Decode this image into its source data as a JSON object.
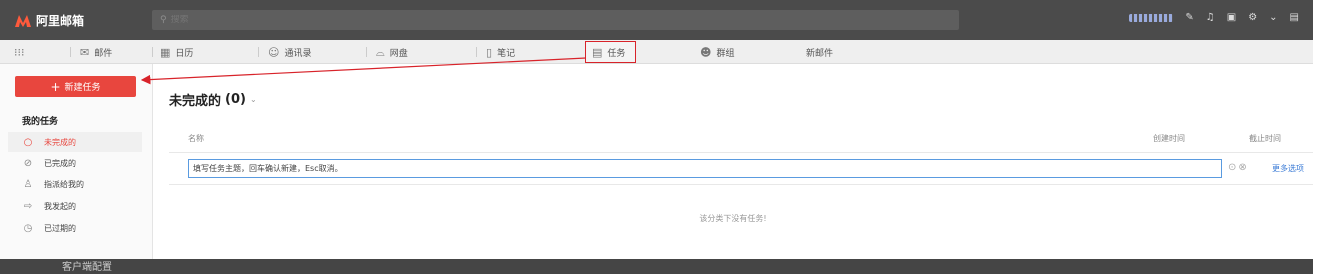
{
  "app": {
    "logo_text": "阿里邮箱"
  },
  "search": {
    "placeholder": "搜索"
  },
  "nav": {
    "items": [
      {
        "label": "邮件"
      },
      {
        "label": "日历"
      },
      {
        "label": "通讯录"
      },
      {
        "label": "网盘"
      },
      {
        "label": "笔记"
      },
      {
        "label": "任务"
      },
      {
        "label": "群组"
      },
      {
        "label": "新邮件"
      }
    ]
  },
  "sidebar": {
    "new_task_label": "新建任务",
    "section_title": "我的任务",
    "items": [
      {
        "label": "未完成的",
        "icon": "circle-icon"
      },
      {
        "label": "已完成的",
        "icon": "check-circle-icon"
      },
      {
        "label": "指派给我的",
        "icon": "user-icon"
      },
      {
        "label": "我发起的",
        "icon": "arrow-icon"
      },
      {
        "label": "已过期的",
        "icon": "clock-icon"
      }
    ]
  },
  "main": {
    "title": "未完成的",
    "count": "(0)",
    "columns": {
      "name": "名称",
      "created": "创建时间",
      "deadline": "截止时间"
    },
    "input_value": "填写任务主题，回车确认新建，Esc取消。",
    "more_options": "更多选项",
    "empty_message": "该分类下没有任务!"
  },
  "footer": {
    "text": "客户端配置"
  },
  "colors": {
    "accent": "#e8463e",
    "highlight_border": "#d8232a",
    "link": "#3b7bd6"
  }
}
